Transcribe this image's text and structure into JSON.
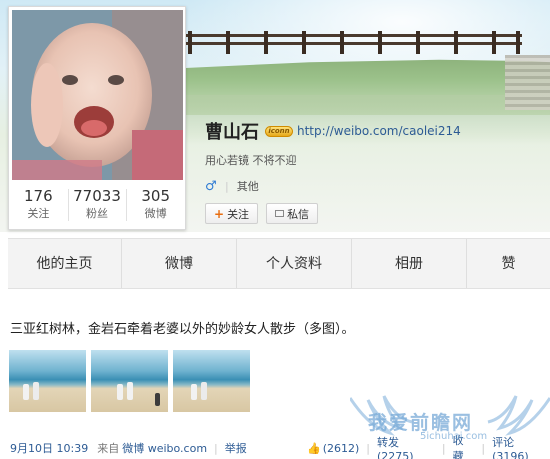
{
  "profile": {
    "name": "曹山石",
    "vip_badge": "iconn",
    "link": "http://weibo.com/caolei214",
    "bio": "用心若镜 不将不迎",
    "gender_icon": "♂",
    "location": "其他",
    "follow_label": "关注",
    "message_label": "私信"
  },
  "stats": [
    {
      "num": "176",
      "label": "关注"
    },
    {
      "num": "77033",
      "label": "粉丝"
    },
    {
      "num": "305",
      "label": "微博"
    }
  ],
  "tabs": [
    "他的主页",
    "微博",
    "个人资料",
    "相册",
    "赞"
  ],
  "post": {
    "text": "三亚红树林，金岩石牵着老婆以外的妙龄女人散步（多图）。",
    "date": "9月10日 10:39",
    "source_prefix": "来自",
    "source": "微博 weibo.com",
    "report": "举报",
    "like": "(2612)",
    "repost": "转发(2275)",
    "favorite": "收藏",
    "comment": "评论(3196)"
  },
  "watermark": {
    "text": "我爱前瞻网",
    "sub": "5ichuhai.com"
  },
  "colors": {
    "link": "#2d5b94",
    "tab_bg": "#f3f3f3",
    "vip_gold": "#e6a91a"
  }
}
